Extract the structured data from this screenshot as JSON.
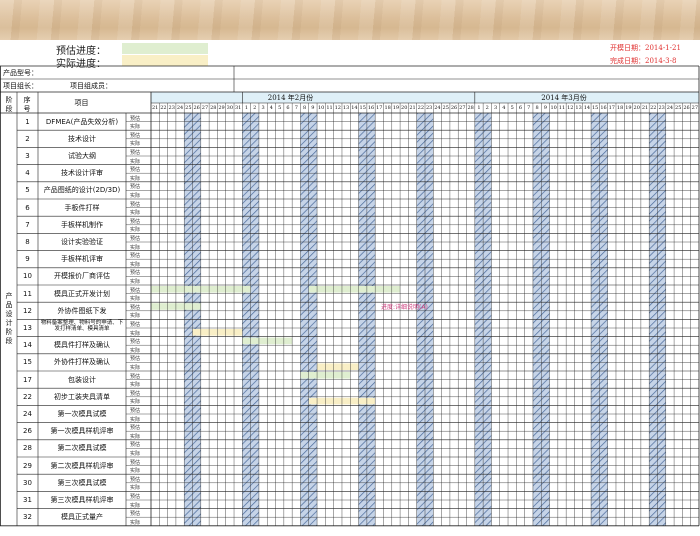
{
  "header": {
    "estimated_progress_label": "预估进度：",
    "actual_progress_label": "实际进度：",
    "start_date_label": "开模日期：2014-1-21",
    "finish_date_label": "完成日期：2014-3-8",
    "estimated_color": "#dfeed0",
    "actual_color": "#f9efc6"
  },
  "info": {
    "product_model_label": "产品型号：",
    "project_leader_label": "项目组长：",
    "project_members_label": "项目组成员："
  },
  "table_headers": {
    "stage": "阶段",
    "seq": "序号",
    "item": "项目"
  },
  "months": [
    "2014 年2月份",
    "2014 年3月份"
  ],
  "days": [
    "21",
    "22",
    "23",
    "24",
    "25",
    "26",
    "27",
    "28",
    "29",
    "30",
    "31",
    "1",
    "2",
    "3",
    "4",
    "5",
    "6",
    "7",
    "8",
    "9",
    "10",
    "11",
    "12",
    "13",
    "14",
    "15",
    "16",
    "17",
    "18",
    "19",
    "20",
    "21",
    "22",
    "23",
    "24",
    "25",
    "26",
    "27",
    "28",
    "1",
    "2",
    "3",
    "4",
    "5",
    "6",
    "7",
    "8",
    "9",
    "10",
    "11",
    "12",
    "13",
    "14",
    "15",
    "16",
    "17",
    "18",
    "19",
    "20",
    "21",
    "22",
    "23",
    "24",
    "25",
    "26",
    "27"
  ],
  "weekend_day_indices": [
    4,
    5,
    11,
    12,
    18,
    19,
    25,
    26,
    32,
    33,
    39,
    40,
    46,
    47,
    53,
    54,
    60,
    61
  ],
  "stage_name": "产品设计阶段",
  "row_kinds": [
    "预估",
    "实际"
  ],
  "tasks": [
    {
      "no": "1",
      "name": "DFMEA(产品失效分析)"
    },
    {
      "no": "2",
      "name": "技术设计"
    },
    {
      "no": "3",
      "name": "试验大纲"
    },
    {
      "no": "4",
      "name": "技术设计评审"
    },
    {
      "no": "5",
      "name": "产品图纸的设计(2D/3D)"
    },
    {
      "no": "6",
      "name": "手板件打样"
    },
    {
      "no": "7",
      "name": "手板样机制作"
    },
    {
      "no": "8",
      "name": "设计实验验证"
    },
    {
      "no": "9",
      "name": "手板样机评审"
    },
    {
      "no": "10",
      "name": "开模报价厂商评估"
    },
    {
      "no": "11",
      "name": "模具正式开发计划"
    },
    {
      "no": "12",
      "name": "外协件图纸下发"
    },
    {
      "no": "13",
      "name": "物料备案整理、物料号的申请、下发打样清单、模具清单"
    },
    {
      "no": "14",
      "name": "模具件打样及确认"
    },
    {
      "no": "15",
      "name": "外协件打样及确认"
    },
    {
      "no": "17",
      "name": "包装设计"
    },
    {
      "no": "22",
      "name": "初步工装夹具清单"
    },
    {
      "no": "24",
      "name": "第一次模具试模"
    },
    {
      "no": "26",
      "name": "第一次模具样机评审"
    },
    {
      "no": "28",
      "name": "第二次模具试模"
    },
    {
      "no": "29",
      "name": "第二次模具样机评审"
    },
    {
      "no": "30",
      "name": "第三次模具试模"
    },
    {
      "no": "31",
      "name": "第三次模具样机评审"
    },
    {
      "no": "32",
      "name": "模具正式量产"
    }
  ],
  "bars": [
    {
      "task": 10,
      "kind": "estimate",
      "start": 0,
      "end": 12
    },
    {
      "task": 10,
      "kind": "estimate",
      "start": 19,
      "end": 30
    },
    {
      "task": 11,
      "kind": "estimate",
      "start": 0,
      "end": 6
    },
    {
      "task": 12,
      "kind": "actual",
      "start": 5,
      "end": 11
    },
    {
      "task": 13,
      "kind": "estimate",
      "start": 11,
      "end": 17
    },
    {
      "task": 14,
      "kind": "actual",
      "start": 20,
      "end": 25
    },
    {
      "task": 15,
      "kind": "estimate",
      "start": 18,
      "end": 24
    },
    {
      "task": 16,
      "kind": "actual",
      "start": 19,
      "end": 27
    }
  ],
  "annotation": "进度:详细说明(A)"
}
